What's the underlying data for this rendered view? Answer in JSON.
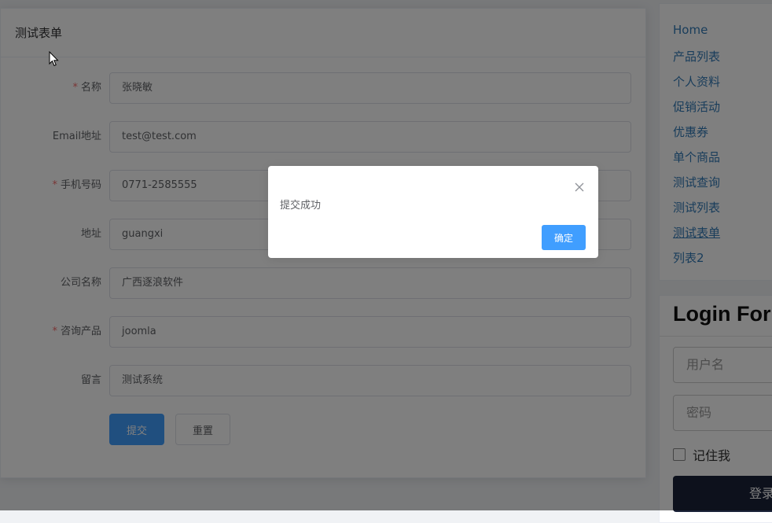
{
  "form": {
    "title": "测试表单",
    "fields": [
      {
        "label": "名称",
        "required": "*",
        "value": "张晓敏"
      },
      {
        "label": "Email地址",
        "required": "",
        "value": "test@test.com"
      },
      {
        "label": "手机号码",
        "required": "*",
        "value": "0771-2585555"
      },
      {
        "label": "地址",
        "required": "",
        "value": "guangxi"
      },
      {
        "label": "公司名称",
        "required": "",
        "value": "广西逐浪软件"
      },
      {
        "label": "咨询产品",
        "required": "*",
        "value": "joomla"
      },
      {
        "label": "留言",
        "required": "",
        "value": "测试系统"
      }
    ],
    "submit_label": "提交",
    "reset_label": "重置"
  },
  "nav": {
    "items": [
      {
        "label": "Home"
      },
      {
        "label": "产品列表"
      },
      {
        "label": "个人资料"
      },
      {
        "label": "促销活动"
      },
      {
        "label": "优惠券"
      },
      {
        "label": "单个商品"
      },
      {
        "label": "测试查询"
      },
      {
        "label": "测试列表"
      },
      {
        "label": "测试表单"
      },
      {
        "label": "列表2"
      }
    ],
    "active": "测试表单"
  },
  "login": {
    "title": "Login Form",
    "username_placeholder": "用户名",
    "password_placeholder": "密码",
    "remember_label": "记住我",
    "login_button": "登录"
  },
  "dialog": {
    "message": "提交成功",
    "confirm_label": "确定"
  },
  "colors": {
    "primary": "#409eff",
    "required": "#f56c6c",
    "link": "#337ab7",
    "login_button": "#1a2238"
  }
}
